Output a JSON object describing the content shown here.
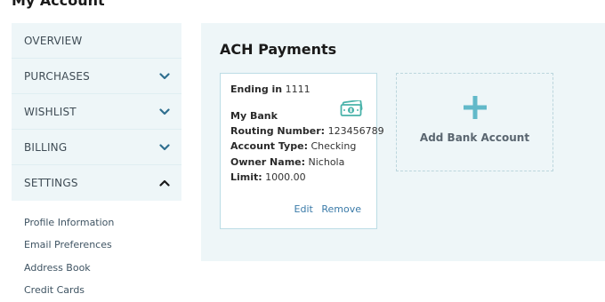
{
  "page": {
    "title": "My Account"
  },
  "sidebar": {
    "items": [
      {
        "label": "OVERVIEW",
        "chevron": null
      },
      {
        "label": "PURCHASES",
        "chevron": "chevron-down-icon"
      },
      {
        "label": "WISHLIST",
        "chevron": "chevron-down-icon"
      },
      {
        "label": "BILLING",
        "chevron": "chevron-down-icon"
      },
      {
        "label": "SETTINGS",
        "chevron": "chevron-up-icon"
      }
    ],
    "settings_subitems": [
      "Profile Information",
      "Email Preferences",
      "Address Book",
      "Credit Cards"
    ]
  },
  "main": {
    "title": "ACH Payments",
    "card": {
      "ending_label": "Ending in",
      "ending_value": "1111",
      "bank_name": "My Bank",
      "routing_label": "Routing Number:",
      "routing_value": "123456789",
      "account_type_label": "Account Type:",
      "account_type_value": "Checking",
      "owner_label": "Owner Name:",
      "owner_value": "Nichola",
      "limit_label": "Limit:",
      "limit_value": "1000.00",
      "icon": "money-icon",
      "edit_label": "Edit",
      "remove_label": "Remove"
    },
    "add_bank": {
      "label": "Add Bank Account",
      "icon": "plus-icon"
    }
  },
  "colors": {
    "panel_bg": "#eef6f8",
    "accent_teal": "#4ab3aa",
    "plus_teal": "#62b9c9",
    "link_blue": "#3a7aa8"
  }
}
